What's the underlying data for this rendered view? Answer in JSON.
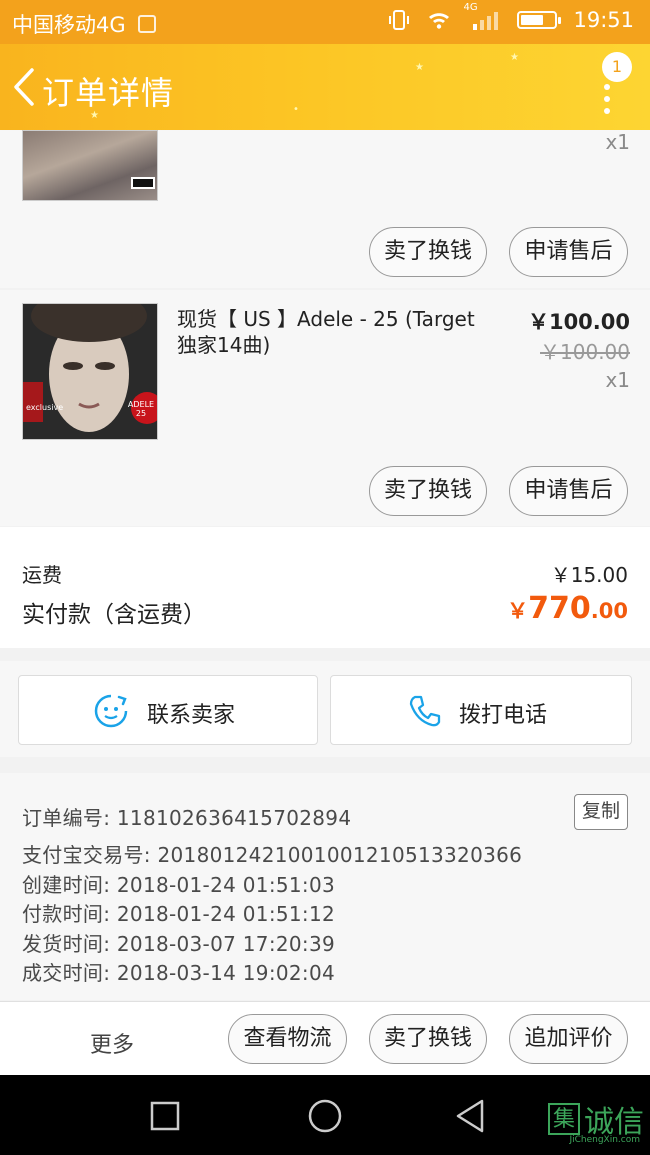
{
  "status_bar": {
    "carrier": "中国移动4G",
    "network_badge": "4G",
    "time": "19:51",
    "icons": [
      "sim-card-icon",
      "vibrate-icon",
      "wifi-icon",
      "signal-icon",
      "battery-icon"
    ]
  },
  "nav": {
    "title": "订单详情",
    "badge_count": "1",
    "back_icon": "chevron-left-icon",
    "more_icon": "more-vertical-icon"
  },
  "items": [
    {
      "qty": "x1",
      "actions": [
        "卖了换钱",
        "申请售后"
      ]
    },
    {
      "title": "现货【 US 】Adele - 25 (Target独家14曲)",
      "price": "￥100.00",
      "original_price": "￥100.00",
      "qty": "x1",
      "cover_text": "ADELE 25",
      "cover_sticker": "exclusive",
      "actions": [
        "卖了换钱",
        "申请售后"
      ]
    }
  ],
  "summary": {
    "shipping_label": "运费",
    "shipping_value": "￥15.00",
    "total_label": "实付款（含运费）",
    "total_symbol": "￥",
    "total_integer": "770",
    "total_decimal": ".00"
  },
  "contact": {
    "seller_label": "联系卖家",
    "seller_icon": "chat-face-icon",
    "phone_label": "拨打电话",
    "phone_icon": "phone-icon"
  },
  "order_info": {
    "order_no": "订单编号: 1181026364157028​94",
    "copy_label": "复制",
    "alipay_no": "支付宝交易号: 2018012421001001210513320366",
    "created": "创建时间:  2018-01-24 01:51:03",
    "paid": "付款时间:  2018-01-24 01:51:12",
    "shipped": "发货时间:  2018-03-07 17:20:39",
    "completed": "成交时间:  2018-03-14 19:02:04"
  },
  "footer": {
    "more": "更多",
    "actions": [
      "查看物流",
      "卖了换钱",
      "追加评价"
    ]
  },
  "watermark": {
    "char": "集",
    "text": "诚信",
    "sub": "JiChengXin.com"
  },
  "colors": {
    "status_bar": "#f3a21c",
    "nav_gradient_start": "#f9b41e",
    "nav_gradient_end": "#fdd532",
    "total_price": "#f25a0d",
    "contact_icon": "#1aa3e8",
    "watermark": "#3ca55a"
  }
}
